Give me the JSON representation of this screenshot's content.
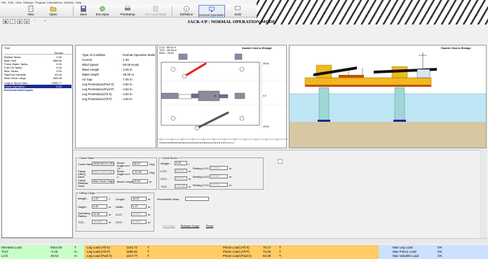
{
  "menu": [
    "File",
    "Edit",
    "View",
    "Settings",
    "Program",
    "Calculations",
    "Window",
    "Help"
  ],
  "toolbar": {
    "new": "New",
    "open": "Open",
    "save": "Save",
    "env_input": "Env.Input",
    "print_setup": "PrintSetup",
    "pre_load_mngr": "Pre-Load Mngr",
    "definition": "Definition",
    "normal_operation": "Normal Operation",
    "jacking": "Jacki"
  },
  "title": "JACK-UP : NORMAL OPERATION MODE",
  "tree": {
    "header": "Tree",
    "col_label": "Tonnes",
    "rows": [
      {
        "label": "Ballast Tanks",
        "value": "0.00"
      },
      {
        "label": "Main Hull",
        "value": "568.50"
      },
      {
        "label": "Fresh Water Tanks",
        "value": "0.00"
      },
      {
        "label": "Fuel Oil Tanks",
        "value": "0.00"
      },
      {
        "label": "Misc Tanks",
        "value": "0.00"
      },
      {
        "label": "Rig/Gold Variable",
        "value": "43.16"
      },
      {
        "label": "Main Deck Cargo",
        "value": "605.48"
      },
      {
        "label": "Legs & Spud Cans",
        "value": "2306.77"
      },
      {
        "label": "Crane Operation",
        "value": "0.00"
      },
      {
        "label": "Environmental Inputs",
        "value": ""
      }
    ]
  },
  "info": {
    "rows": [
      {
        "k": "Type of Condition",
        "v": ": Normal Operation Mode"
      },
      {
        "k": "Current",
        "v": ": 1.00"
      },
      {
        "k": "Wind Speed",
        "v": ": 60.00 Knots"
      },
      {
        "k": "Wave Height",
        "v": ": 2.00 m"
      },
      {
        "k": "Water Depth",
        "v": ": 45.00 m"
      },
      {
        "k": "Air Gap",
        "v": ": 7.00 m"
      },
      {
        "k": "Leg Penetration(Fwd S)",
        "v": ": 4.50 m"
      },
      {
        "k": "Leg Penetration(Fwd P)",
        "v": ": 4.50 m"
      },
      {
        "k": "Leg Penetration(Aft S)",
        "v": ": 4.50 m"
      },
      {
        "k": "Leg Penetration(Aft P)",
        "v": ": 4.50 m"
      }
    ]
  },
  "plan": {
    "lines": [
      "LCG : 85.41 ft",
      "TCG : 35.98 m",
      "Pitch : 94.51"
    ],
    "enlarge": "Double Click to Enlarge",
    "right_label_1": "25.00",
    "right_label_2": "0.0",
    "right_label_3": "25.00",
    "scale": "70 68 66 64 62 60 58 56 54 52 50 48 46 44 42 40 38 36 34 32 30 28 26 24 22 20 18 16 14 12 10 8 6 4 2 0 -2 -4"
  },
  "side": {
    "enlarge": "Double Click to Enlarge"
  },
  "crane": {
    "data_title": "Crane Data",
    "crane_name_label": "Crane Name:",
    "crane_name_value": "MAIN DECK CRA",
    "cargo_lifting_label": "Cargo Lifting Deck:",
    "cargo_lifting_value": "Main Deck Cargo",
    "cargo_release_label": "Cargo Release Deck:",
    "cargo_release_value": "Main Deck Cargo",
    "boom_angle_cl_label": "Boom Angle w.r.t CL :",
    "boom_angle_cl_value": "55.87",
    "deg": "Deg",
    "boom_angle_lcl_label": "Boom Angle w.r.t L:",
    "boom_angle_lcl_value": "-32.96",
    "boom_length_label": "Boom Length :",
    "boom_length_value": "40.40",
    "m": "m",
    "boom_title": "Crane Boom",
    "weight_label": "Weight :",
    "weight_value": "0.00",
    "t": "t",
    "lcg_label": "LCG :",
    "lcg_value": "40.604",
    "vcg_label": "VCG :",
    "vcg_value": "26.913",
    "tcg_label": "TCG :",
    "tcg_value": "-23.288",
    "res_lcg_label": "Resting LCG :",
    "res_lcg_value": "91.336",
    "res_vcg_label": "Resting VCG :",
    "res_vcg_value": "26.563",
    "res_tcg_label": "Resting TCG :",
    "res_tcg_value": "12.774",
    "lift_title": "Lifting Cargo",
    "l_weight_label": "Weight :",
    "l_weight_value": "1.25",
    "T": "T",
    "height_label": "Height :",
    "height_value": "5.40",
    "radius_label": "Operating Radius :",
    "radius_value": "24.56",
    "l_tcg_label": "TCG :",
    "l_tcg_value": "-38.880",
    "length_label": "Length :",
    "length_value": "18.00",
    "width_label": "Width :",
    "width_value": "5.10",
    "l_lcg_label": "LCG :",
    "l_lcg_value": "23.524",
    "l_vcg_label": "VCG :",
    "l_vcg_value": "81.806",
    "permissible_label": "Permissible Hook :",
    "lift_btn": "Lift Cargo",
    "release_btn": "Release Cargo",
    "reset_btn": "Reset"
  },
  "status": {
    "c1": [
      {
        "k": "Elevated Load",
        "v": "6024.50",
        "u": "T"
      },
      {
        "k": "TCG",
        "v": "-0.45",
        "u": "m"
      },
      {
        "k": "LCG",
        "v": "20.52",
        "u": "m"
      }
    ],
    "c2": [
      {
        "k": "Leg Load (Aft S)",
        "v": "1122.72",
        "u": "T"
      },
      {
        "k": "Leg Load (Aft P)",
        "v": "1189.42",
        "u": "T"
      },
      {
        "k": "Leg Load (Fwd S)",
        "v": "1217.77",
        "u": "T"
      }
    ],
    "c3": [
      {
        "k": "Pinion Load (Aft S)",
        "v": "70.17",
        "u": "T"
      },
      {
        "k": "Pinion Load (Aft P)",
        "v": "74.34",
        "u": "T"
      },
      {
        "k": "Pinion Load (Fwd S)",
        "v": "82.30",
        "u": "T"
      }
    ],
    "c4": [
      {
        "k": "Max Leg Load",
        "v": "OK"
      },
      {
        "k": "Max Pinion Load",
        "v": "OK"
      },
      {
        "k": "Max Variable Load",
        "v": "OK"
      }
    ]
  },
  "colors": {
    "status_green": "#c8ffc8",
    "status_orange": "#ffcc66",
    "status_blue": "#cce0ff",
    "selected": "#1d2b8f",
    "sea": "#bfe6f5",
    "seabed": "#d7c7a3"
  }
}
